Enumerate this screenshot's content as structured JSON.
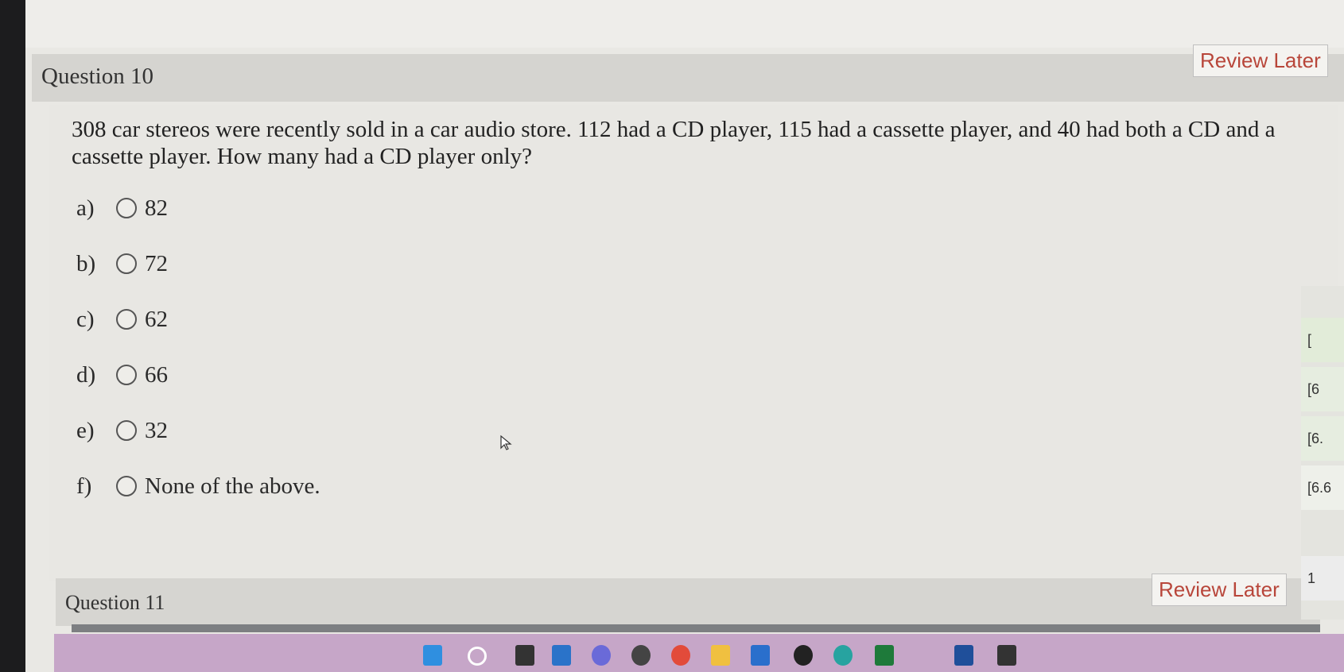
{
  "question10": {
    "title": "Question 10",
    "review_label": "Review Later",
    "text": "308 car stereos were recently sold in a car audio store.  112 had a CD player, 115 had a cassette player, and 40 had both a CD and a cassette player.  How many had a CD player only?",
    "choices": [
      {
        "letter": "a)",
        "value": "82"
      },
      {
        "letter": "b)",
        "value": "72"
      },
      {
        "letter": "c)",
        "value": "62"
      },
      {
        "letter": "d)",
        "value": "66"
      },
      {
        "letter": "e)",
        "value": "32"
      },
      {
        "letter": "f)",
        "value": "None of the above."
      }
    ]
  },
  "question11": {
    "title": "Question 11",
    "review_label": "Review Later"
  },
  "side_panel": {
    "items": [
      "[",
      "[6",
      "[6.",
      "[6.6",
      "1"
    ]
  },
  "colors": {
    "review_text": "#b8463a",
    "header_bg": "#d5d4d0",
    "taskbar_bg": "#c6a6c8"
  },
  "taskbar_icons": [
    "windows-icon",
    "search-icon",
    "task-view-icon",
    "widgets-icon",
    "chat-icon",
    "settings-icon",
    "chrome-icon",
    "file-explorer-icon",
    "store-icon",
    "app-icon",
    "edge-icon",
    "app-icon",
    "app-icon",
    "app-icon"
  ]
}
